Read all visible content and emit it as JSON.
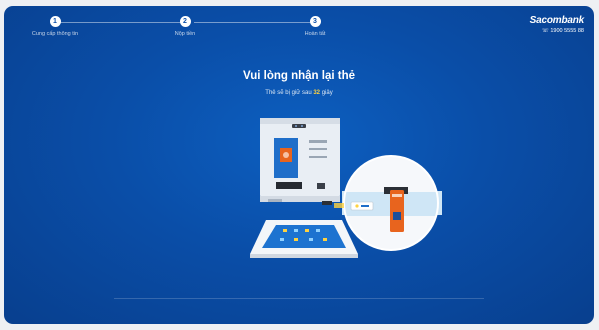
{
  "steps": [
    {
      "number": "1",
      "label": "Cung cấp thông tin"
    },
    {
      "number": "2",
      "label": "Nộp tiền"
    },
    {
      "number": "3",
      "label": "Hoàn tất"
    }
  ],
  "brand": {
    "name": "Sacombank",
    "phone": "1900 5555 88"
  },
  "main": {
    "title": "Vui lòng nhận lại thẻ",
    "subtitle_before": "Thẻ sẽ bị giữ sau",
    "seconds": "32",
    "subtitle_after": "giây"
  },
  "colors": {
    "background": "#0a4ea8",
    "accent": "#ffd23f",
    "card": "#e8641e"
  },
  "icons": {
    "phone": "phone-icon"
  }
}
